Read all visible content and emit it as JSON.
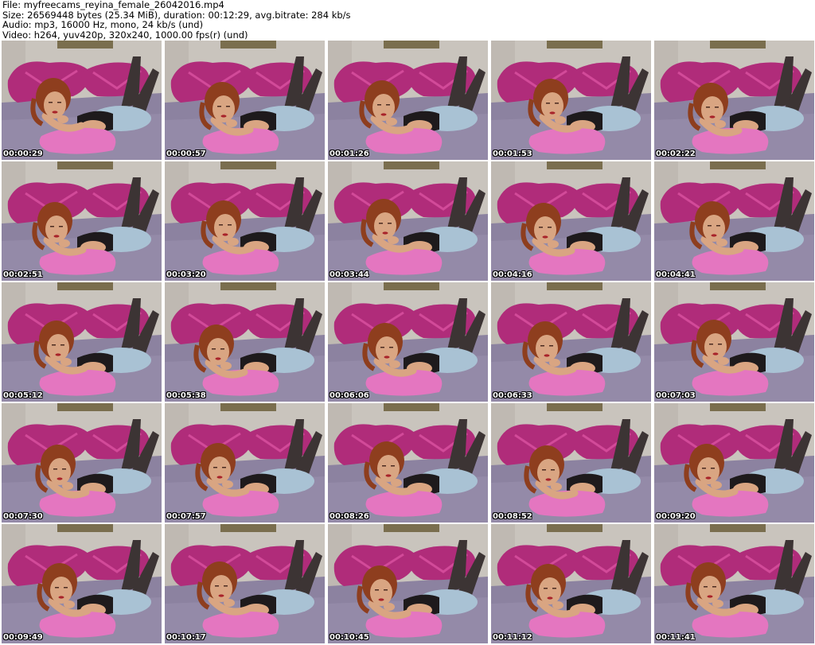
{
  "header": {
    "file_line": "File: myfreecams_reyina_female_26042016.mp4",
    "size_line": "Size: 26569448 bytes (25.34 MiB), duration: 00:12:29, avg.bitrate: 284 kb/s",
    "audio_line": "Audio: mp3, 16000 Hz, mono, 24 kb/s (und)",
    "video_line": "Video: h264, yuv420p, 320x240, 1000.00 fps(r) (und)"
  },
  "thumbnails": [
    {
      "timestamp": "00:00:29"
    },
    {
      "timestamp": "00:00:57"
    },
    {
      "timestamp": "00:01:26"
    },
    {
      "timestamp": "00:01:53"
    },
    {
      "timestamp": "00:02:22"
    },
    {
      "timestamp": "00:02:51"
    },
    {
      "timestamp": "00:03:20"
    },
    {
      "timestamp": "00:03:44"
    },
    {
      "timestamp": "00:04:16"
    },
    {
      "timestamp": "00:04:41"
    },
    {
      "timestamp": "00:05:12"
    },
    {
      "timestamp": "00:05:38"
    },
    {
      "timestamp": "00:06:06"
    },
    {
      "timestamp": "00:06:33"
    },
    {
      "timestamp": "00:07:03"
    },
    {
      "timestamp": "00:07:30"
    },
    {
      "timestamp": "00:07:57"
    },
    {
      "timestamp": "00:08:26"
    },
    {
      "timestamp": "00:08:52"
    },
    {
      "timestamp": "00:09:20"
    },
    {
      "timestamp": "00:09:49"
    },
    {
      "timestamp": "00:10:17"
    },
    {
      "timestamp": "00:10:45"
    },
    {
      "timestamp": "00:11:12"
    },
    {
      "timestamp": "00:11:41"
    }
  ],
  "colors": {
    "wall": "#c9c4bd",
    "bed": "#8c82a0",
    "pillow": "#b02c7a",
    "pink_pillow": "#e476c0",
    "hair": "#8e3e1e",
    "skin": "#d9a582",
    "shorts": "#a9c2d4",
    "top": "#1e1a1c",
    "stockings": "#3c3434"
  }
}
